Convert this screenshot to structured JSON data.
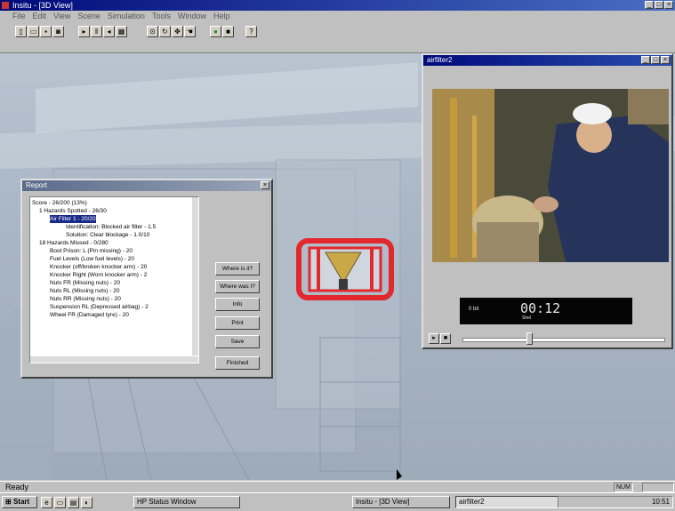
{
  "app": {
    "title": "Insitu - [3D View]"
  },
  "menu": [
    "File",
    "Edit",
    "View",
    "Scene",
    "Simulation",
    "Tools",
    "Window",
    "Help"
  ],
  "report_window": {
    "title": "Report",
    "tree": [
      "Score - 26/200 (13%)",
      "1 Hazards Spotted - 26/30",
      "Air Filter 1 - 20/20",
      "Identification: Blocked air filter - 1.5",
      "Solution: Clear blockage - 1.0/10",
      "18 Hazards Missed - 0/280",
      "Boot Prison: L (Pin missing) - 20",
      "Fuel Levels (Low fuel levels) - 20",
      "Knocker (off/broken knocker arm) - 20",
      "Knocker Right (Worn knocker arm) - 2",
      "Nuts FR (Missing nuts) - 20",
      "Nuts RL (Missing nuts) - 20",
      "Nuts RR (Missing nuts) - 20",
      "Suspension RL (Depressed airbag) - 2",
      "Wheel FR (Damaged tyre) - 20"
    ],
    "buttons": [
      "Where is it?",
      "Where was I?",
      "Info",
      "Print",
      "Save",
      "Finished"
    ]
  },
  "video_window": {
    "title": "airfilter2",
    "time": "00:12",
    "left_label": "0 bit",
    "sub_label": "Shel",
    "position_fraction": 0.33
  },
  "status": {
    "text": "Ready",
    "box1": "NUM"
  },
  "taskbar": {
    "start": "Start",
    "items": [
      "HP Status Window",
      "Insitu - [3D View]",
      "airfilter2"
    ],
    "tray": "10:51"
  },
  "colors": {
    "highlight": "#e2282c",
    "title_active": "#000a7a"
  }
}
